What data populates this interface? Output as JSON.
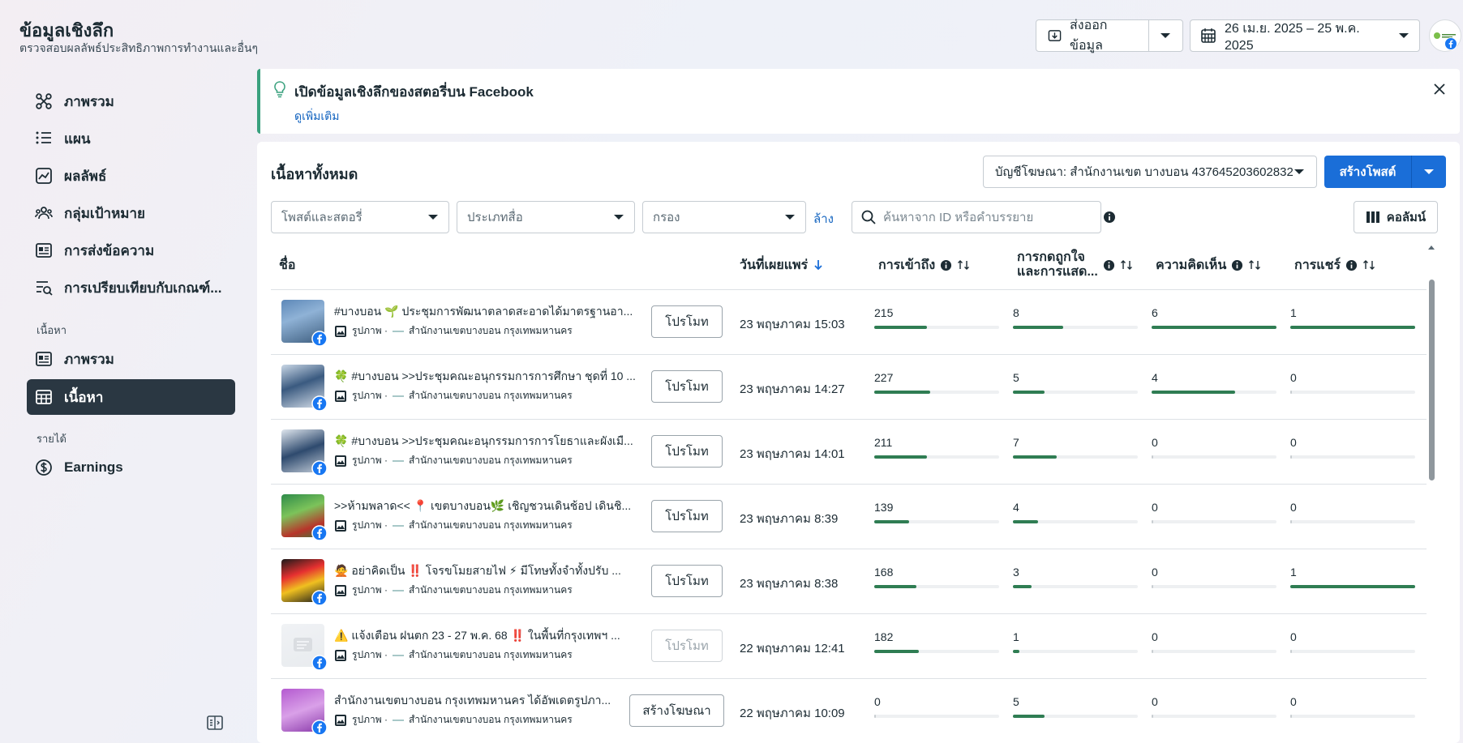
{
  "header": {
    "title": "ข้อมูลเชิงลึก",
    "subtitle": "ตรวจสอบผลลัพธ์ประสิทธิภาพการทำงานและอื่นๆ",
    "export_label": "ส่งออกข้อมูล",
    "date_range": "26 เม.ย. 2025 – 25 พ.ค. 2025"
  },
  "sidebar": {
    "items": [
      {
        "label": "ภาพรวม",
        "icon": "overview-icon"
      },
      {
        "label": "แผน",
        "icon": "list-icon"
      },
      {
        "label": "ผลลัพธ์",
        "icon": "chart-icon"
      },
      {
        "label": "กลุ่มเป้าหมาย",
        "icon": "audience-icon"
      },
      {
        "label": "การส่งข้อความ",
        "icon": "message-icon"
      },
      {
        "label": "การเปรียบเทียบกับเกณฑ์...",
        "icon": "benchmark-icon"
      }
    ],
    "content_section": "เนื้อหา",
    "content_items": [
      {
        "label": "ภาพรวม",
        "icon": "card-icon"
      },
      {
        "label": "เนื้อหา",
        "icon": "table-icon",
        "active": true
      }
    ],
    "earnings_section": "รายได้",
    "earnings_items": [
      {
        "label": "Earnings",
        "icon": "dollar-icon"
      }
    ]
  },
  "notice": {
    "title": "เปิดข้อมูลเชิงลึกของสตอรี่บน Facebook",
    "link": "ดูเพิ่มเติม"
  },
  "content": {
    "title": "เนื้อหาทั้งหมด",
    "account": "บัญชีโฆษณา: สำนักงานเขต บางบอน 437645203602832",
    "create_label": "สร้างโพสต์",
    "filters": {
      "post_type": "โพสต์และสตอรี่",
      "media_type": "ประเภทสื่อ",
      "filter": "กรอง",
      "clear": "ล้าง",
      "search_placeholder": "ค้นหาจาก ID หรือคำบรรยาย",
      "columns": "คอลัมน์"
    },
    "columns": {
      "name": "ชื่อ",
      "date": "วันที่เผยแพร่",
      "reach": "การเข้าถึง",
      "reactions_line1": "การกดถูกใจ",
      "reactions_line2": "และการแสด...",
      "comments": "ความคิดเห็น",
      "shares": "การแชร์"
    },
    "rows": [
      {
        "title": "#บางบอน 🌱 ประชุมการพัฒนาตลาดสะอาดได้มาตรฐานอา...",
        "type": "รูปภาพ ·",
        "page": "สำนักงานเขตบางบอน กรุงเทพมหานคร",
        "action": "โปรโมท",
        "date": "23 พฤษภาคม 15:03",
        "reach": "215",
        "reach_frac": 0.42,
        "reactions": "8",
        "reactions_frac": 0.4,
        "comments": "6",
        "comments_frac": 1.0,
        "shares": "1",
        "shares_frac": 1.0
      },
      {
        "title": "🍀 #บางบอน >>ประชุมคณะอนุกรรมการการศึกษา ชุดที่ 10 ...",
        "type": "รูปภาพ ·",
        "page": "สำนักงานเขตบางบอน กรุงเทพมหานคร",
        "action": "โปรโมท",
        "date": "23 พฤษภาคม 14:27",
        "reach": "227",
        "reach_frac": 0.45,
        "reactions": "5",
        "reactions_frac": 0.25,
        "comments": "4",
        "comments_frac": 0.67,
        "shares": "0",
        "shares_frac": 0
      },
      {
        "title": "🍀 #บางบอน >>ประชุมคณะอนุกรรมการการโยธาและผังเมื...",
        "type": "รูปภาพ ·",
        "page": "สำนักงานเขตบางบอน กรุงเทพมหานคร",
        "action": "โปรโมท",
        "date": "23 พฤษภาคม 14:01",
        "reach": "211",
        "reach_frac": 0.42,
        "reactions": "7",
        "reactions_frac": 0.35,
        "comments": "0",
        "comments_frac": 0,
        "shares": "0",
        "shares_frac": 0
      },
      {
        "title": ">>ห้ามพลาด<< 📍 เขตบางบอน🌿 เชิญชวนเดินช้อป เดินชิ...",
        "type": "รูปภาพ ·",
        "page": "สำนักงานเขตบางบอน กรุงเทพมหานคร",
        "action": "โปรโมท",
        "date": "23 พฤษภาคม 8:39",
        "reach": "139",
        "reach_frac": 0.28,
        "reactions": "4",
        "reactions_frac": 0.2,
        "comments": "0",
        "comments_frac": 0,
        "shares": "0",
        "shares_frac": 0
      },
      {
        "title": "🙅 อย่าคิดเป็น ‼️ โจรขโมยสายไฟ ⚡ มีโทษทั้งจำทั้งปรับ ...",
        "type": "รูปภาพ ·",
        "page": "สำนักงานเขตบางบอน กรุงเทพมหานคร",
        "action": "โปรโมท",
        "date": "23 พฤษภาคม 8:38",
        "reach": "168",
        "reach_frac": 0.34,
        "reactions": "3",
        "reactions_frac": 0.15,
        "comments": "0",
        "comments_frac": 0,
        "shares": "1",
        "shares_frac": 1.0
      },
      {
        "title": "⚠️ แจ้งเตือน ฝนตก 23 - 27 พ.ค. 68 ‼️ ในพื้นที่กรุงเทพฯ ...",
        "type": "รูปภาพ ·",
        "page": "สำนักงานเขตบางบอน กรุงเทพมหานคร",
        "action": "โปรโมท",
        "action_disabled": true,
        "date": "22 พฤษภาคม 12:41",
        "reach": "182",
        "reach_frac": 0.36,
        "reactions": "1",
        "reactions_frac": 0.05,
        "comments": "0",
        "comments_frac": 0,
        "shares": "0",
        "shares_frac": 0
      },
      {
        "title": "สำนักงานเขตบางบอน กรุงเทพมหานคร ได้อัพเดตรูปภา...",
        "type": "รูปภาพ ·",
        "page": "สำนักงานเขตบางบอน กรุงเทพมหานคร",
        "action": "สร้างโฆษณา",
        "date": "22 พฤษภาคม 10:09",
        "reach": "0",
        "reach_frac": 0,
        "reactions": "5",
        "reactions_frac": 0.25,
        "comments": "0",
        "comments_frac": 0,
        "shares": "0",
        "shares_frac": 0
      }
    ]
  },
  "colors": {
    "accent": "#1a6ed8",
    "bar_fill": "#2f7d53",
    "active_nav": "#2a3742",
    "notice_border": "#3aa17e"
  }
}
